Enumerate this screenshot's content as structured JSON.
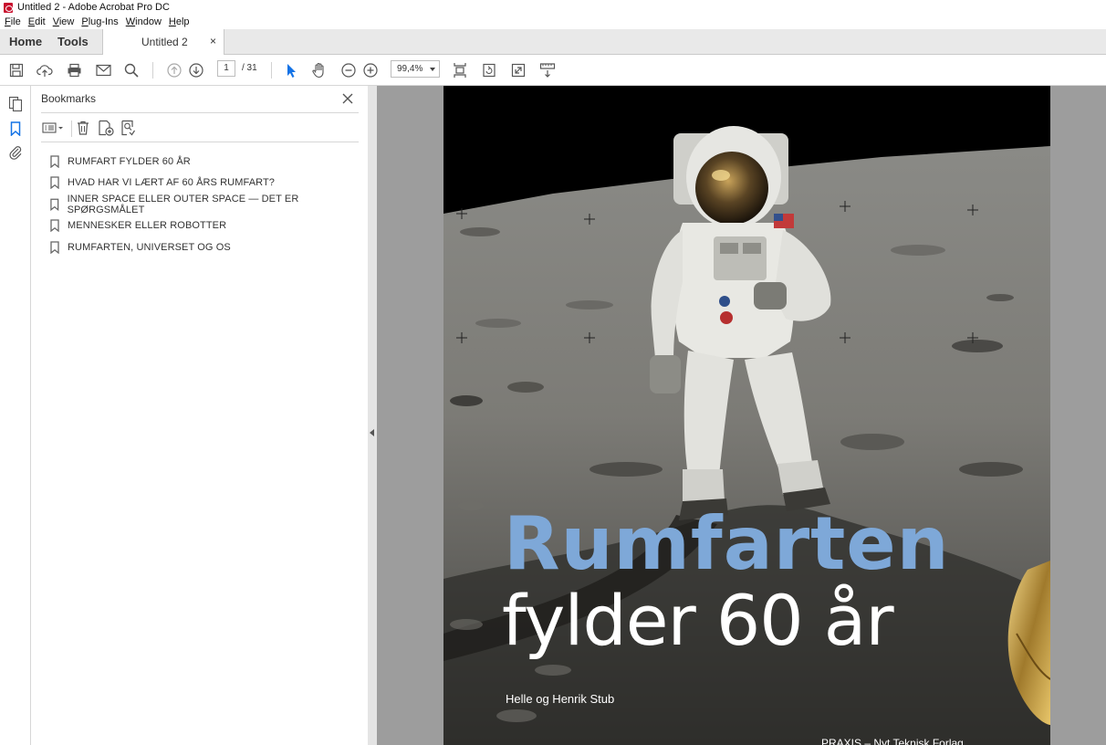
{
  "window": {
    "title": "Untitled 2 - Adobe Acrobat Pro DC",
    "icon": "acrobat-icon"
  },
  "menu": [
    "File",
    "Edit",
    "View",
    "Plug-Ins",
    "Window",
    "Help"
  ],
  "tabs": {
    "home": "Home",
    "tools": "Tools",
    "document": "Untitled 2",
    "close": "×"
  },
  "toolbar": {
    "page_current": "1",
    "page_total": "/ 31",
    "zoom": "99,4%"
  },
  "bookmarks_panel": {
    "title": "Bookmarks",
    "items": [
      "RUMFART FYLDER 60 ÅR",
      "HVAD HAR VI LÆRT AF 60 ÅRS RUMFART?",
      "INNER SPACE ELLER OUTER SPACE — DET ER SPØRGSMÅLET",
      "MENNESKER ELLER ROBOTTER",
      "RUMFARTEN, UNIVERSET OG OS"
    ]
  },
  "cover": {
    "title_line1": "Rumfarten",
    "title_line2": "fylder 60 år",
    "authors": "Helle og Henrik Stub",
    "footer": "PRAXIS – Nyt Teknisk Forlag"
  },
  "colors": {
    "title_blue": "#7ea8d8",
    "accent_blue": "#1473e6",
    "doc_background": "#9d9d9d"
  }
}
